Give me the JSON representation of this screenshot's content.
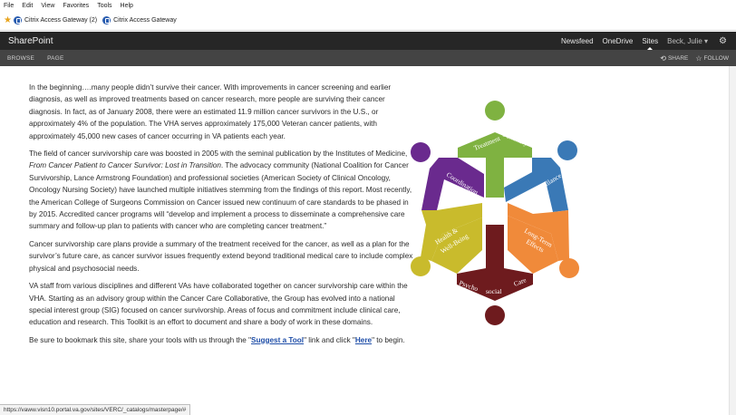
{
  "browser": {
    "menu": [
      "File",
      "Edit",
      "View",
      "Favorites",
      "Tools",
      "Help"
    ],
    "favorites": [
      "Citrix Access Gateway (2)",
      "Citrix Access Gateway"
    ]
  },
  "suite": {
    "brand": "SharePoint",
    "nav": [
      "Newsfeed",
      "OneDrive",
      "Sites"
    ],
    "user": "Beck, Julie ▾"
  },
  "ribbon": {
    "tabs": [
      "BROWSE",
      "PAGE"
    ],
    "share": "SHARE",
    "follow": "FOLLOW"
  },
  "content": {
    "p1": "In the beginning….many people didn’t survive their cancer.  With improvements in cancer screening and earlier diagnosis, as well as improved treatments based on cancer research, more people are surviving their cancer diagnosis.  In fact, as of January 2008, there were an estimated 11.9 million cancer survivors in the U.S., or approximately 4% of the population. The VHA serves approximately 175,000 Veteran cancer patients, with approximately 45,000 new cases of cancer occurring in VA patients each year.",
    "p2a": "The field of cancer survivorship care was boosted in 2005 with the seminal publication by the Institutes of Medicine, ",
    "p2_em": "From Cancer Patient to Cancer Survivor: Lost in Transition",
    "p2b": ".  The advocacy community (National Coalition for Cancer Survivorship, Lance Armstrong Foundation) and professional societies (American Society of Clinical Oncology, Oncology Nursing Society) have launched multiple initiatives stemming from the findings of this report.  Most recently, the American College of Surgeons Commission on Cancer issued new continuum of care standards to be phased in by 2015.  Accredited cancer programs will “develop and implement a process to disseminate a comprehensive care summary and follow-up plan to patients with cancer who are completing cancer treatment.”",
    "p3": "Cancer survivorship care plans provide a summary of the treatment received for the cancer, as well as a plan for the survivor’s future care, as cancer survivor issues  frequently extend beyond traditional medical care to include complex physical and psychosocial needs.",
    "p4": "VA staff from various disciplines and different VAs have collaborated together on cancer survivorship care within the VHA.  Starting as an advisory group within the Cancer Care Collaborative, the Group has evolved into a national special interest group (SIG) focused on cancer survivorship.  Areas of focus and commitment include clinical care, education and research.  This Toolkit is an effort to document and share a body of work in these domains.",
    "p5a": "Be sure to bookmark this site, share your tools with us through the \"",
    "link1": "Suggest a Tool",
    "p5b": "\" link and click \"",
    "link2": "Here",
    "p5c": "\" to begin."
  },
  "diagram": {
    "labels": {
      "treatment": "Treatment",
      "summary": "Summary",
      "surveillance": "Surveillance",
      "long_term": "Long-Term",
      "effects": "Effects",
      "psycho": "Psycho",
      "social": "social",
      "care": "Care",
      "health": "Health &",
      "well_being": "Well-Being",
      "coordination": "Coordination",
      "of_care": "of Care"
    },
    "colors": {
      "green": "#7fb241",
      "blue": "#3a79b6",
      "orange": "#f08a3a",
      "maroon": "#6e1b1e",
      "yellow": "#c9bb2c",
      "purple": "#6a2a8e"
    }
  },
  "status": {
    "url": "https://vaww.visn10.portal.va.gov/sites/VERC/_catalogs/masterpage/#"
  }
}
